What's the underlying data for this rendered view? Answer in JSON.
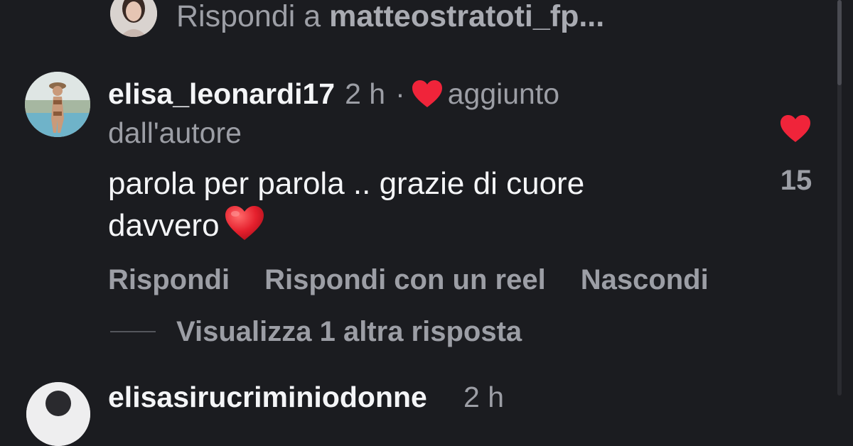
{
  "reply_to": {
    "prefix": "Rispondi a ",
    "username": "matteostratoti_fp..."
  },
  "comment": {
    "username": "elisa_leonardi17",
    "time": "2 h",
    "separator": "·",
    "added_label": "aggiunto",
    "added_label_line2": "dall'autore",
    "text": "parola per parola .. grazie di cuore davvero",
    "text_line1": "parola per parola .. grazie di cuore",
    "text_line2": "davvero",
    "likes": "15",
    "actions": {
      "reply": "Rispondi",
      "reply_reel": "Rispondi con un reel",
      "hide": "Nascondi"
    },
    "view_more": "Visualizza 1 altra risposta"
  },
  "next_comment": {
    "username_partial": "elisasirucriminiodonne",
    "time_partial": "2 h"
  },
  "colors": {
    "background": "#1b1c20",
    "heart": "#f0243a",
    "muted_text": "#9c9ea5",
    "primary_text": "#f4f5f7"
  },
  "icons": {
    "author_liked": "heart-icon",
    "like_button": "heart-icon",
    "emoji": "red-heart-emoji"
  }
}
